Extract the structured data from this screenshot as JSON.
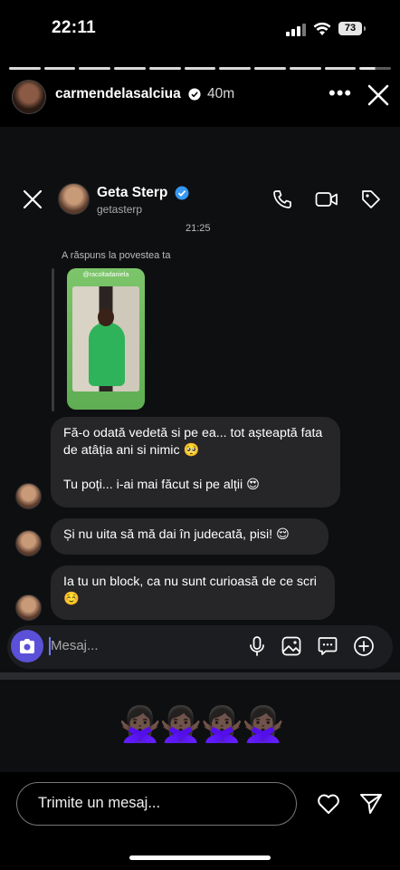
{
  "status_bar": {
    "time": "22:11",
    "battery": "73"
  },
  "story": {
    "username": "carmendelasalciua",
    "time_ago": "40m",
    "more_label": "•••"
  },
  "dm": {
    "name": "Geta Sterp",
    "handle": "getasterp",
    "timestamp": "21:25",
    "replied_label": "A răspuns la povestea ta",
    "story_caption": "@racoltadaniela",
    "messages": [
      {
        "text": "Fă-o odată vedetă si pe ea... tot așteaptă fata de atâția ani si nimic 🥺\n\nTu poți... i-ai mai făcut si pe alții 😍"
      },
      {
        "text": "Și nu uita să mă dai în judecată, pisi! 😌"
      },
      {
        "text": "Ia tu un block, ca nu sunt curioasă de ce scri ☺️"
      }
    ],
    "composer_placeholder": "Mesaj..."
  },
  "reactions": {
    "emojis": "🙅🏿‍♀️🙅🏿‍♀️🙅🏿‍♀️🙅🏿‍♀️"
  },
  "reply_bar": {
    "placeholder": "Trimite un mesaj..."
  },
  "icons": [
    "signal-icon",
    "wifi-icon",
    "battery-icon",
    "verified-icon",
    "more-icon",
    "close-icon",
    "phone-icon",
    "video-icon",
    "tag-icon",
    "camera-icon",
    "microphone-icon",
    "gallery-icon",
    "sticker-icon",
    "plus-icon",
    "heart-icon",
    "send-icon"
  ]
}
